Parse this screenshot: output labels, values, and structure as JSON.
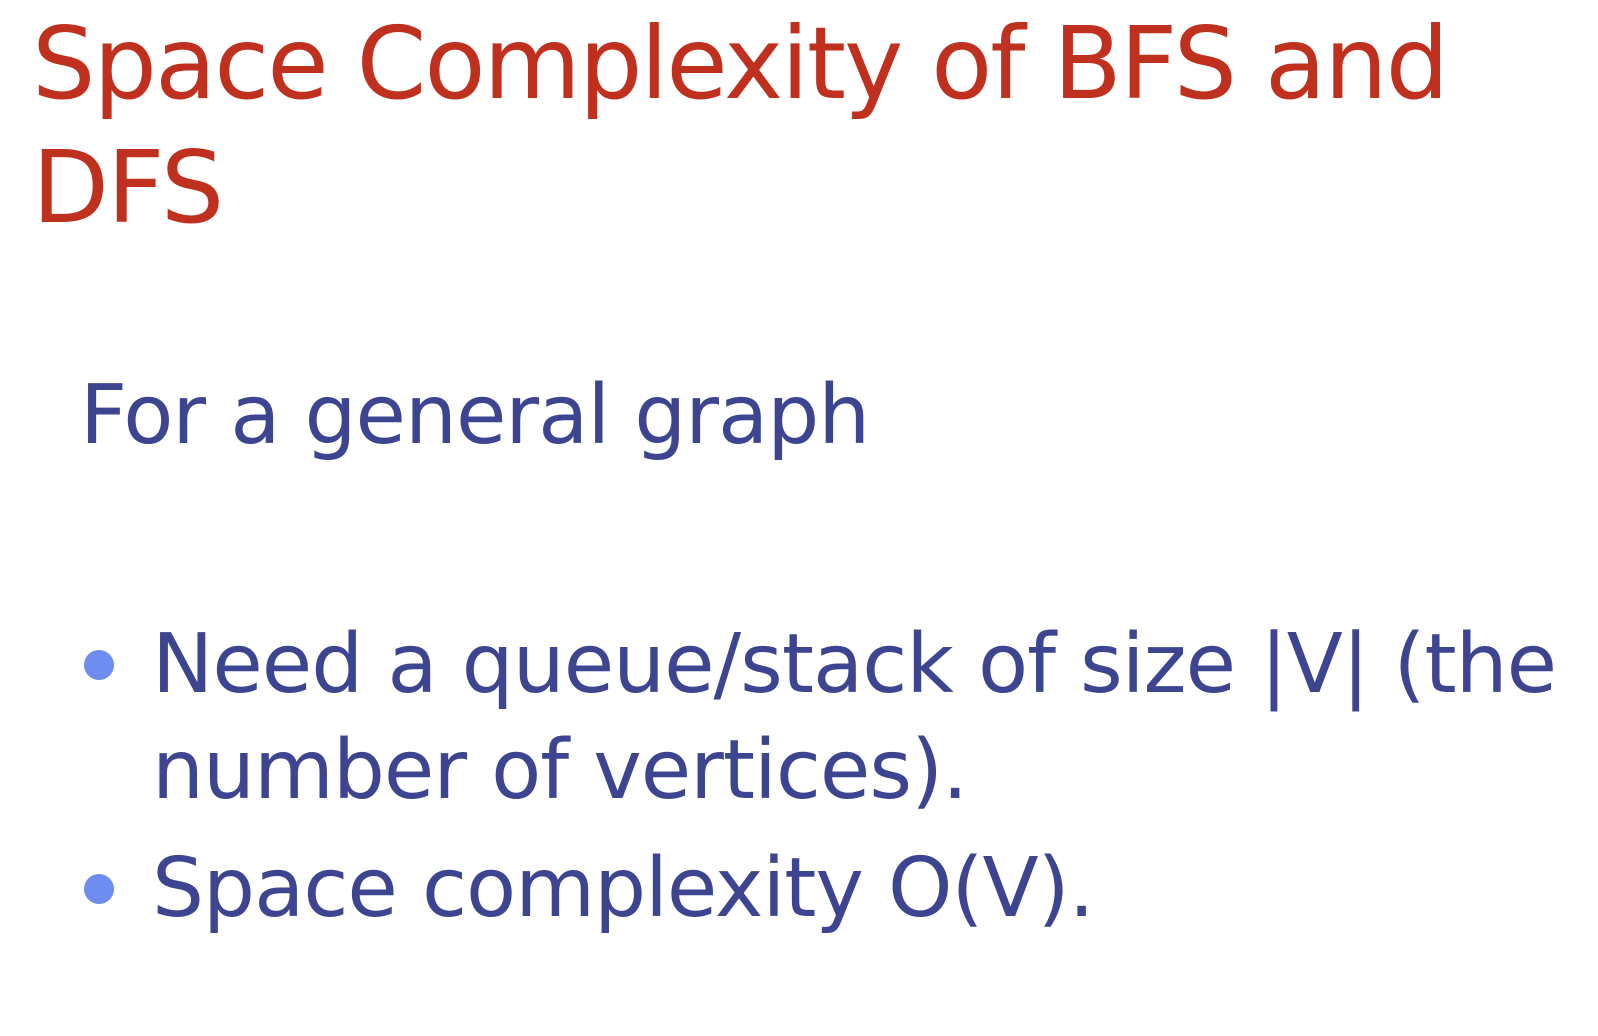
{
  "slide": {
    "title": "Space Complexity of BFS and DFS",
    "subtitle": "For a general graph",
    "bullets": [
      "Need a queue/stack of size |V| (the number of vertices).",
      "Space complexity O(V)."
    ],
    "colors": {
      "title": "#c0301e",
      "body": "#3d4590",
      "bullet_marker": "#6f8cf0",
      "background": "#ffffff"
    }
  }
}
